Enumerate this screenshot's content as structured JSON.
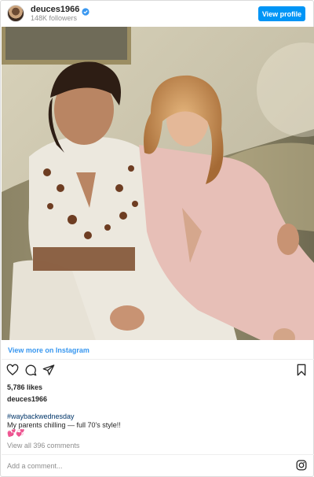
{
  "header": {
    "username": "deuces1966",
    "followers": "148K followers",
    "view_profile_label": "View profile",
    "verified_icon": "verified-badge-icon"
  },
  "post": {
    "view_more_label": "View more on Instagram",
    "likes": "5,786 likes",
    "author": "deuces1966",
    "hashtag": "#waybackwednesday",
    "caption": "My parents chilling — full 70's style!!",
    "emojis": "💕💞",
    "view_comments": "View all 396 comments",
    "add_comment_placeholder": "Add a comment..."
  },
  "icons": {
    "like": "heart-icon",
    "comment": "comment-icon",
    "share": "share-icon",
    "save": "bookmark-icon",
    "instagram": "instagram-logo-icon"
  },
  "colors": {
    "button": "#0095f6",
    "link": "#3897f0",
    "hashtag": "#003569",
    "muted": "#8e8e8e"
  }
}
